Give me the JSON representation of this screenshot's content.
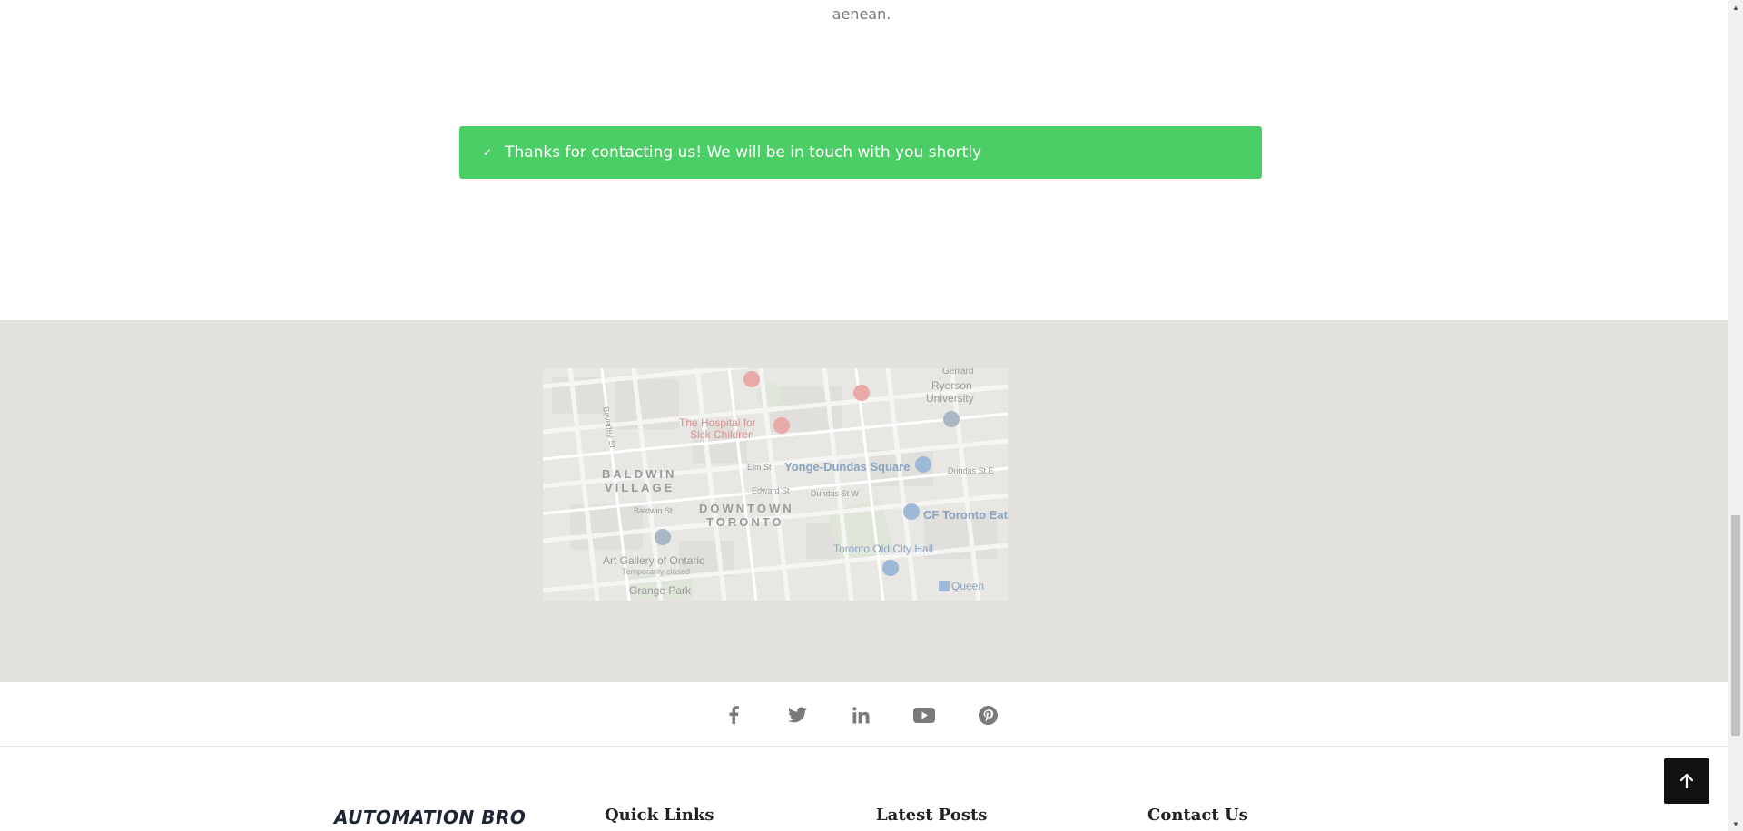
{
  "intro": {
    "trailing_text": "aenean."
  },
  "alert": {
    "icon": "check-icon",
    "message": "Thanks for contacting us! We will be in touch with you shortly",
    "color": "#4cce66"
  },
  "map": {
    "labels": {
      "ryerson": "Ryerson",
      "university": "University",
      "hospital_line1": "The Hospital for",
      "hospital_line2": "Sick Children",
      "baldwin": "BALDWIN",
      "village": "VILLAGE",
      "downtown": "DOWNTOWN",
      "toronto": "TORONTO",
      "yonge_dundas": "Yonge-Dundas Square",
      "cf_toronto": "CF Toronto Eat",
      "city_hall": "Toronto Old City Hall",
      "ago": "Art Gallery of Ontario",
      "temporarily_closed": "Temporarily closed",
      "grange": "Grange Park",
      "queen": "Queen",
      "dundas_st_e": "Dundas St E",
      "dundas_st_w": "Dundas St W",
      "edward_st": "Edward St",
      "elm_st": "Elm St",
      "baldwin_st": "Baldwin St",
      "beverley_st": "Beverley St",
      "gerrard": "Gerrard"
    }
  },
  "social": {
    "icons": [
      "facebook-icon",
      "twitter-icon",
      "linkedin-icon",
      "youtube-icon",
      "pinterest-icon"
    ]
  },
  "footer": {
    "brand": "AUTOMATION BRO",
    "quick_links": "Quick Links",
    "latest_posts": "Latest Posts",
    "contact_us": "Contact Us"
  },
  "back_to_top": {
    "icon": "arrow-up-icon"
  }
}
